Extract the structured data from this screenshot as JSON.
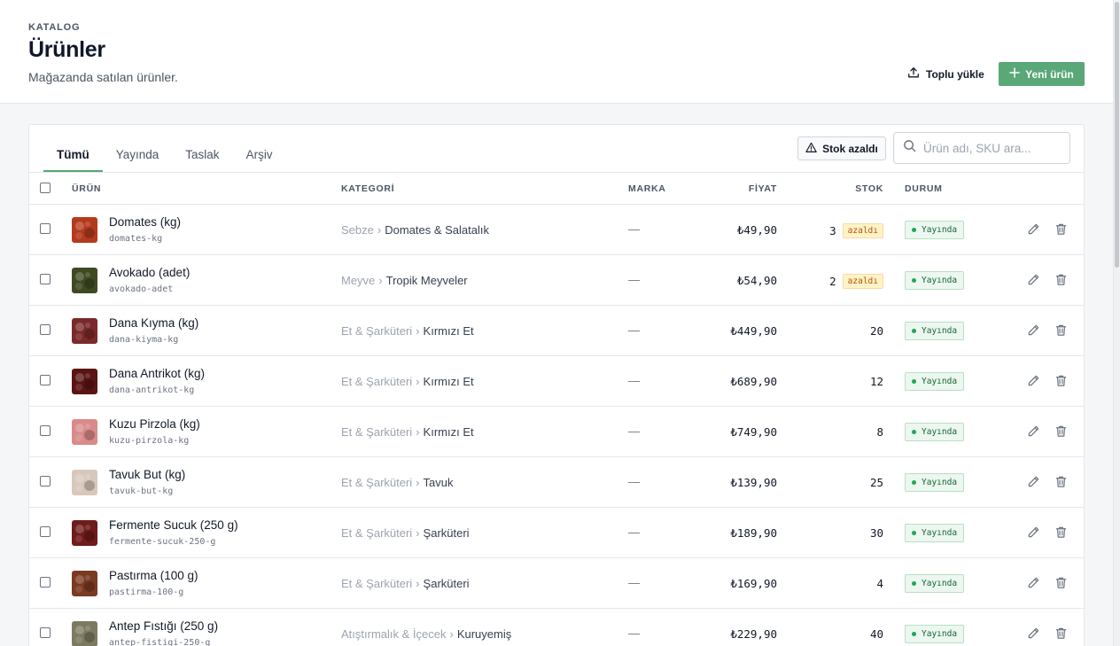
{
  "header": {
    "eyebrow": "KATALOG",
    "title": "Ürünler",
    "subtitle": "Mağazanda satılan ürünler.",
    "bulk_upload_label": "Toplu yükle",
    "new_product_label": "Yeni ürün"
  },
  "toolbar": {
    "tabs": [
      {
        "label": "Tümü",
        "active": true
      },
      {
        "label": "Yayında",
        "active": false
      },
      {
        "label": "Taslak",
        "active": false
      },
      {
        "label": "Arşiv",
        "active": false
      }
    ],
    "low_stock_label": "Stok azaldı",
    "search_placeholder": "Ürün adı, SKU ara..."
  },
  "table": {
    "columns": {
      "product": "ÜRÜN",
      "category": "KATEGORİ",
      "brand": "MARKA",
      "price": "FİYAT",
      "stock": "STOK",
      "status": "DURUM"
    },
    "rows": [
      {
        "name": "Domates (kg)",
        "sku": "domates-kg",
        "cat_parent": "Sebze",
        "cat_child": "Domates & Salatalık",
        "brand": "—",
        "price": "₺49,90",
        "stock": "3",
        "low_badge": "azaldı",
        "status": "Yayında",
        "thumb_color": "#b43a1e"
      },
      {
        "name": "Avokado (adet)",
        "sku": "avokado-adet",
        "cat_parent": "Meyve",
        "cat_child": "Tropik Meyveler",
        "brand": "—",
        "price": "₺54,90",
        "stock": "2",
        "low_badge": "azaldı",
        "status": "Yayında",
        "thumb_color": "#3f4a22"
      },
      {
        "name": "Dana Kıyma (kg)",
        "sku": "dana-kiyma-kg",
        "cat_parent": "Et & Şarküteri",
        "cat_child": "Kırmızı Et",
        "brand": "—",
        "price": "₺449,90",
        "stock": "20",
        "low_badge": "",
        "status": "Yayında",
        "thumb_color": "#7a2a2a"
      },
      {
        "name": "Dana Antrikot (kg)",
        "sku": "dana-antrikot-kg",
        "cat_parent": "Et & Şarküteri",
        "cat_child": "Kırmızı Et",
        "brand": "—",
        "price": "₺689,90",
        "stock": "12",
        "low_badge": "",
        "status": "Yayında",
        "thumb_color": "#5a1414"
      },
      {
        "name": "Kuzu Pirzola (kg)",
        "sku": "kuzu-pirzola-kg",
        "cat_parent": "Et & Şarküteri",
        "cat_child": "Kırmızı Et",
        "brand": "—",
        "price": "₺749,90",
        "stock": "8",
        "low_badge": "",
        "status": "Yayında",
        "thumb_color": "#d98a8a"
      },
      {
        "name": "Tavuk But (kg)",
        "sku": "tavuk-but-kg",
        "cat_parent": "Et & Şarküteri",
        "cat_child": "Tavuk",
        "brand": "—",
        "price": "₺139,90",
        "stock": "25",
        "low_badge": "",
        "status": "Yayında",
        "thumb_color": "#d8c8bc"
      },
      {
        "name": "Fermente Sucuk (250 g)",
        "sku": "fermente-sucuk-250-g",
        "cat_parent": "Et & Şarküteri",
        "cat_child": "Şarküteri",
        "brand": "—",
        "price": "₺189,90",
        "stock": "30",
        "low_badge": "",
        "status": "Yayında",
        "thumb_color": "#6e1c1c"
      },
      {
        "name": "Pastırma (100 g)",
        "sku": "pastirma-100-g",
        "cat_parent": "Et & Şarküteri",
        "cat_child": "Şarküteri",
        "brand": "—",
        "price": "₺169,90",
        "stock": "4",
        "low_badge": "",
        "status": "Yayında",
        "thumb_color": "#7b3a22"
      },
      {
        "name": "Antep Fıstığı (250 g)",
        "sku": "antep-fistigi-250-g",
        "cat_parent": "Atıştırmalık & İçecek",
        "cat_child": "Kuruyemiş",
        "brand": "—",
        "price": "₺229,90",
        "stock": "40",
        "low_badge": "",
        "status": "Yayında",
        "thumb_color": "#7d7a62"
      }
    ]
  },
  "icons": {
    "upload": "upload-icon",
    "plus": "plus-icon",
    "warning": "warning-triangle-icon",
    "search": "search-icon",
    "edit": "pencil-icon",
    "delete": "trash-icon"
  },
  "colors": {
    "accent": "#5aa777",
    "status_bg": "#ecf7ef",
    "low_badge_bg": "#fef3c7"
  }
}
